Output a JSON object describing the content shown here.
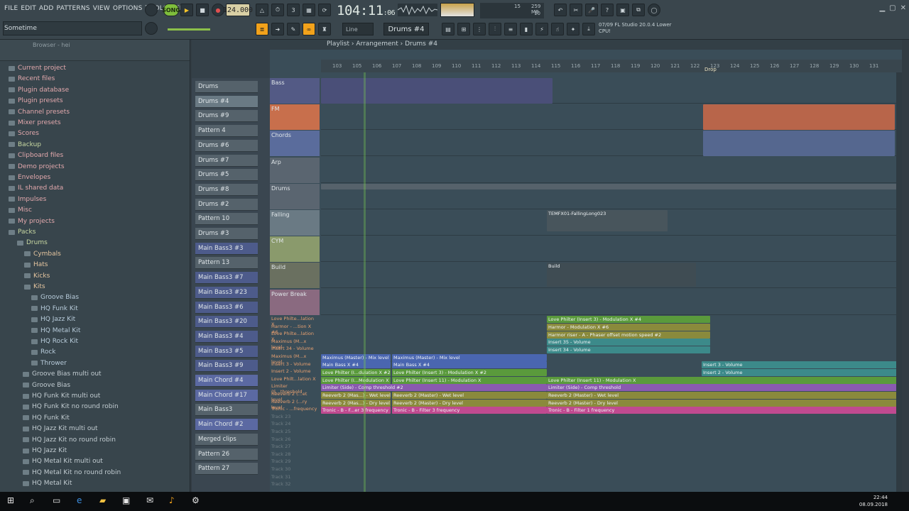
{
  "menu": [
    "FILE",
    "EDIT",
    "ADD",
    "PATTERNS",
    "VIEW",
    "OPTIONS",
    "TOOLS",
    "HELP"
  ],
  "transport": {
    "song_label": "SONG",
    "tempo": "124.000",
    "time_main": "104:11",
    "time_sub": ":06",
    "cpu_top": "15",
    "cpu_mem": "259 MB",
    "cpu_poly": "10"
  },
  "hint_bar": {
    "text": "Sometime"
  },
  "pattern_selector": {
    "value": "Drums #4"
  },
  "snap_selector": {
    "value": "Line"
  },
  "news": {
    "line1": "07/09  FL Studio 20.0.4 Lower",
    "line2": "CPU!"
  },
  "browser": {
    "header": "Browser - hei",
    "items": [
      {
        "label": "Current project"
      },
      {
        "label": "Recent files"
      },
      {
        "label": "Plugin database"
      },
      {
        "label": "Plugin presets"
      },
      {
        "label": "Channel presets"
      },
      {
        "label": "Mixer presets"
      },
      {
        "label": "Scores"
      },
      {
        "label": "Backup"
      },
      {
        "label": "Clipboard files"
      },
      {
        "label": "Demo projects"
      },
      {
        "label": "Envelopes"
      },
      {
        "label": "IL shared data"
      },
      {
        "label": "Impulses"
      },
      {
        "label": "Misc"
      },
      {
        "label": "My projects"
      },
      {
        "label": "Packs"
      },
      {
        "label": "Drums"
      },
      {
        "label": "Cymbals"
      },
      {
        "label": "Hats"
      },
      {
        "label": "Kicks"
      },
      {
        "label": "Kits"
      },
      {
        "label": "Groove Bias"
      },
      {
        "label": "HQ Funk Kit"
      },
      {
        "label": "HQ Jazz Kit"
      },
      {
        "label": "HQ Metal Kit"
      },
      {
        "label": "HQ Rock Kit"
      },
      {
        "label": "Rock"
      },
      {
        "label": "Thrower"
      },
      {
        "label": "Groove Bias multi out"
      },
      {
        "label": "Groove Bias"
      },
      {
        "label": "HQ Funk Kit multi out"
      },
      {
        "label": "HQ Funk Kit no round robin"
      },
      {
        "label": "HQ Funk Kit"
      },
      {
        "label": "HQ Jazz Kit multi out"
      },
      {
        "label": "HQ Jazz Kit no round robin"
      },
      {
        "label": "HQ Jazz Kit"
      },
      {
        "label": "HQ Metal Kit multi out"
      },
      {
        "label": "HQ Metal Kit no round robin"
      },
      {
        "label": "HQ Metal Kit"
      }
    ]
  },
  "patterns": [
    "Drums",
    "Drums #4",
    "Drums #9",
    "Pattern 4",
    "Drums #6",
    "Drums #7",
    "Drums #5",
    "Drums #8",
    "Drums #2",
    "Pattern 10",
    "Drums #3",
    "Main Bass3 #3",
    "Pattern 13",
    "Main Bass3 #7",
    "Main Bass3 #23",
    "Main Bass3 #6",
    "Main Bass3 #20",
    "Main Bass3 #4",
    "Main Bass3 #5",
    "Main Bass3 #9",
    "Main Chord #4",
    "Main Chord #17",
    "Main Bass3",
    "Main Chord #2",
    "Merged clips",
    "Pattern 26",
    "Pattern 27"
  ],
  "playlist": {
    "breadcrumb": [
      "Playlist",
      "Arrangement",
      "Drums #4"
    ],
    "ruler": [
      "103",
      "105",
      "106",
      "107",
      "108",
      "109",
      "110",
      "111",
      "112",
      "113",
      "114",
      "115",
      "116",
      "117",
      "118",
      "119",
      "120",
      "121",
      "122",
      "123",
      "124",
      "125",
      "126",
      "127",
      "128",
      "129",
      "130",
      "131"
    ],
    "marker": "Drop",
    "tracks": [
      "Bass",
      "FM",
      "Chords",
      "Arp",
      "Drums",
      "Falling",
      "CYM",
      "Build",
      "Power Break"
    ],
    "auto_tracks": [
      "Love Philte...lation X",
      "Harmor - ...tion X #6",
      "Love Philte...lation X",
      "Maximus (M...x level",
      "Insert 34 - Volume",
      "Maximus (M...x level",
      "Insert 3 - Volume",
      "Insert 2 - Volume",
      "Love Philt...lation X",
      "Limiter (S...threshold",
      "Reeverb 2 (...et level",
      "Reeverb 2 (...ry level",
      "Tronic - ...frequency",
      "Track 23",
      "Track 24",
      "Track 25",
      "Track 26",
      "Track 27",
      "Track 28",
      "Track 29",
      "Track 30",
      "Track 31",
      "Track 32"
    ],
    "clips": {
      "falling": "TEMFX01-FallingLong023",
      "build": "Build",
      "a1": "Love Philter (Insert 3) - Modulation X #4",
      "a2": "Harmor - Modulation X #6",
      "a3": "Harmor riser - A - Phaser offset motion speed #2",
      "a4": "Insert 35 - Volume",
      "a5": "Insert 34 - Volume",
      "m1": "Maximus (Master) - Mix level",
      "m2": "Maximus (Master) - Mix level",
      "b1": "Main Bass X #4",
      "b2": "Main Bass X #4",
      "l1": "Love Philter (I...dulation X #2",
      "l2": "Love Philter (Insert 3) - Modulation X #2",
      "l3": "Love Philter (I...Modulation X",
      "l4": "Love Philter (Insert 11) - Modulation X",
      "l5": "Love Philter (Insert 11) - Modulation X",
      "lim1": "Limiter (Side) - Comp threshold #2",
      "lim2": "Limiter (Side) - Comp threshold",
      "r1": "Reeverb 2 (Mas...) - Wet level",
      "r2": "Reeverb 2 (Master) - Wet level",
      "r3": "Reeverb 2 (Master) - Wet level",
      "r4": "Reeverb 2 (Mas...) - Dry level",
      "r5": "Reeverb 2 (Master) - Dry level",
      "r6": "Reeverb 2 (Master) - Dry level",
      "t1": "Tronic - B - F...er 3 frequency",
      "t2": "Tronic - B - Filter 3 frequency",
      "t3": "Tronic - B - Filter 1 frequency",
      "i3": "Insert 3 - Volume",
      "i2": "Insert 2 - Volume"
    }
  },
  "taskbar": {
    "time": "22:44",
    "date": "08.09.2018"
  },
  "colors": {
    "accent_green": "#7fbe3c",
    "bass": "#535a85",
    "fm": "#c86f4c",
    "chords": "#5a6c9c",
    "drums": "#5a6570",
    "auto_green": "#5a9a3c",
    "auto_purple": "#8a5ab0",
    "auto_pink": "#c04a90",
    "auto_teal": "#3c8a8a",
    "auto_olive": "#8a8a3c",
    "auto_blue": "#4a66b0"
  }
}
